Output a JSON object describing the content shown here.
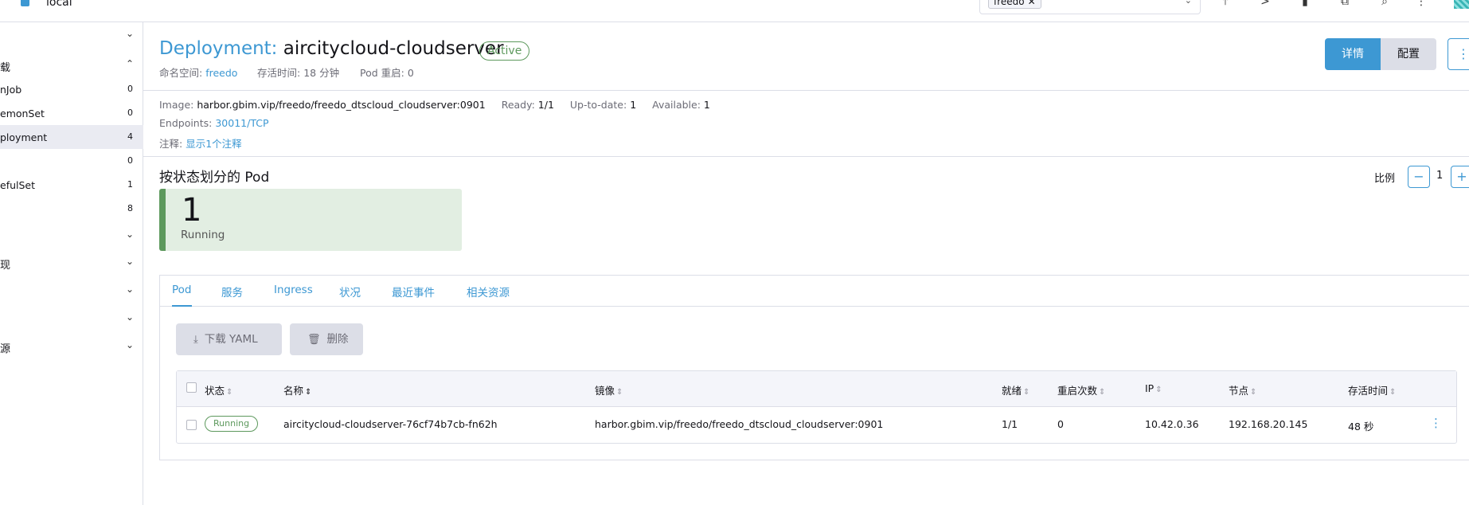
{
  "topbar": {
    "cluster_name": "local",
    "namespace_chip": "freedo",
    "icons": [
      "upload-icon",
      "terminal-icon",
      "file-icon",
      "copy-icon",
      "search-icon",
      "kebab-menu-icon"
    ]
  },
  "sidebar": {
    "groups": [
      {
        "label": ""
      },
      {
        "label": "载"
      },
      {
        "label": ""
      },
      {
        "label": "现"
      },
      {
        "label": ""
      },
      {
        "label": ""
      },
      {
        "label": "源"
      }
    ],
    "items": [
      {
        "label": "nJob",
        "count": "0"
      },
      {
        "label": "emonSet",
        "count": "0"
      },
      {
        "label": "ployment",
        "count": "4"
      },
      {
        "label": "",
        "count": "0"
      },
      {
        "label": "efulSet",
        "count": "1"
      },
      {
        "label": "",
        "count": "8"
      }
    ]
  },
  "header": {
    "kind": "Deployment:",
    "name": "aircitycloud-cloudserver",
    "status": "Active",
    "namespace_label": "命名空间:",
    "namespace_value": "freedo",
    "age_label": "存活时间:",
    "age_value": "18 分钟",
    "restarts_label": "Pod 重启:",
    "restarts_value": "0",
    "btn_detail": "详情",
    "btn_config": "配置",
    "btn_more": "⋮"
  },
  "info": {
    "image_label": "Image:",
    "image_value": "harbor.gbim.vip/freedo/freedo_dtscloud_cloudserver:0901",
    "ready_label": "Ready:",
    "ready_value": "1/1",
    "uptodate_label": "Up-to-date:",
    "uptodate_value": "1",
    "available_label": "Available:",
    "available_value": "1",
    "endpoints_label": "Endpoints:",
    "endpoints_value": "30011/TCP",
    "annotations_label": "注释:",
    "annotations_value": "显示1个注释"
  },
  "pods_section": {
    "heading": "按状态划分的 Pod",
    "scale_label": "比例",
    "scale_value": "1",
    "running_count": "1",
    "running_label": "Running"
  },
  "tabs": [
    "Pod",
    "服务",
    "Ingress",
    "状况",
    "最近事件",
    "相关资源"
  ],
  "actions": {
    "download_yaml": "下载 YAML",
    "delete": "删除"
  },
  "table": {
    "headers": [
      "状态",
      "名称",
      "镜像",
      "就绪",
      "重启次数",
      "IP",
      "节点",
      "存活时间"
    ],
    "rows": [
      {
        "status": "Running",
        "name": "aircitycloud-cloudserver-76cf74b7cb-fn62h",
        "image": "harbor.gbim.vip/freedo/freedo_dtscloud_cloudserver:0901",
        "ready": "1/1",
        "restarts": "0",
        "ip": "10.42.0.36",
        "node": "192.168.20.145",
        "age": "48 秒"
      }
    ]
  },
  "colors": {
    "accent": "#3d98d3",
    "success": "#5d995d",
    "running_card_bg": "#e2eee2"
  }
}
